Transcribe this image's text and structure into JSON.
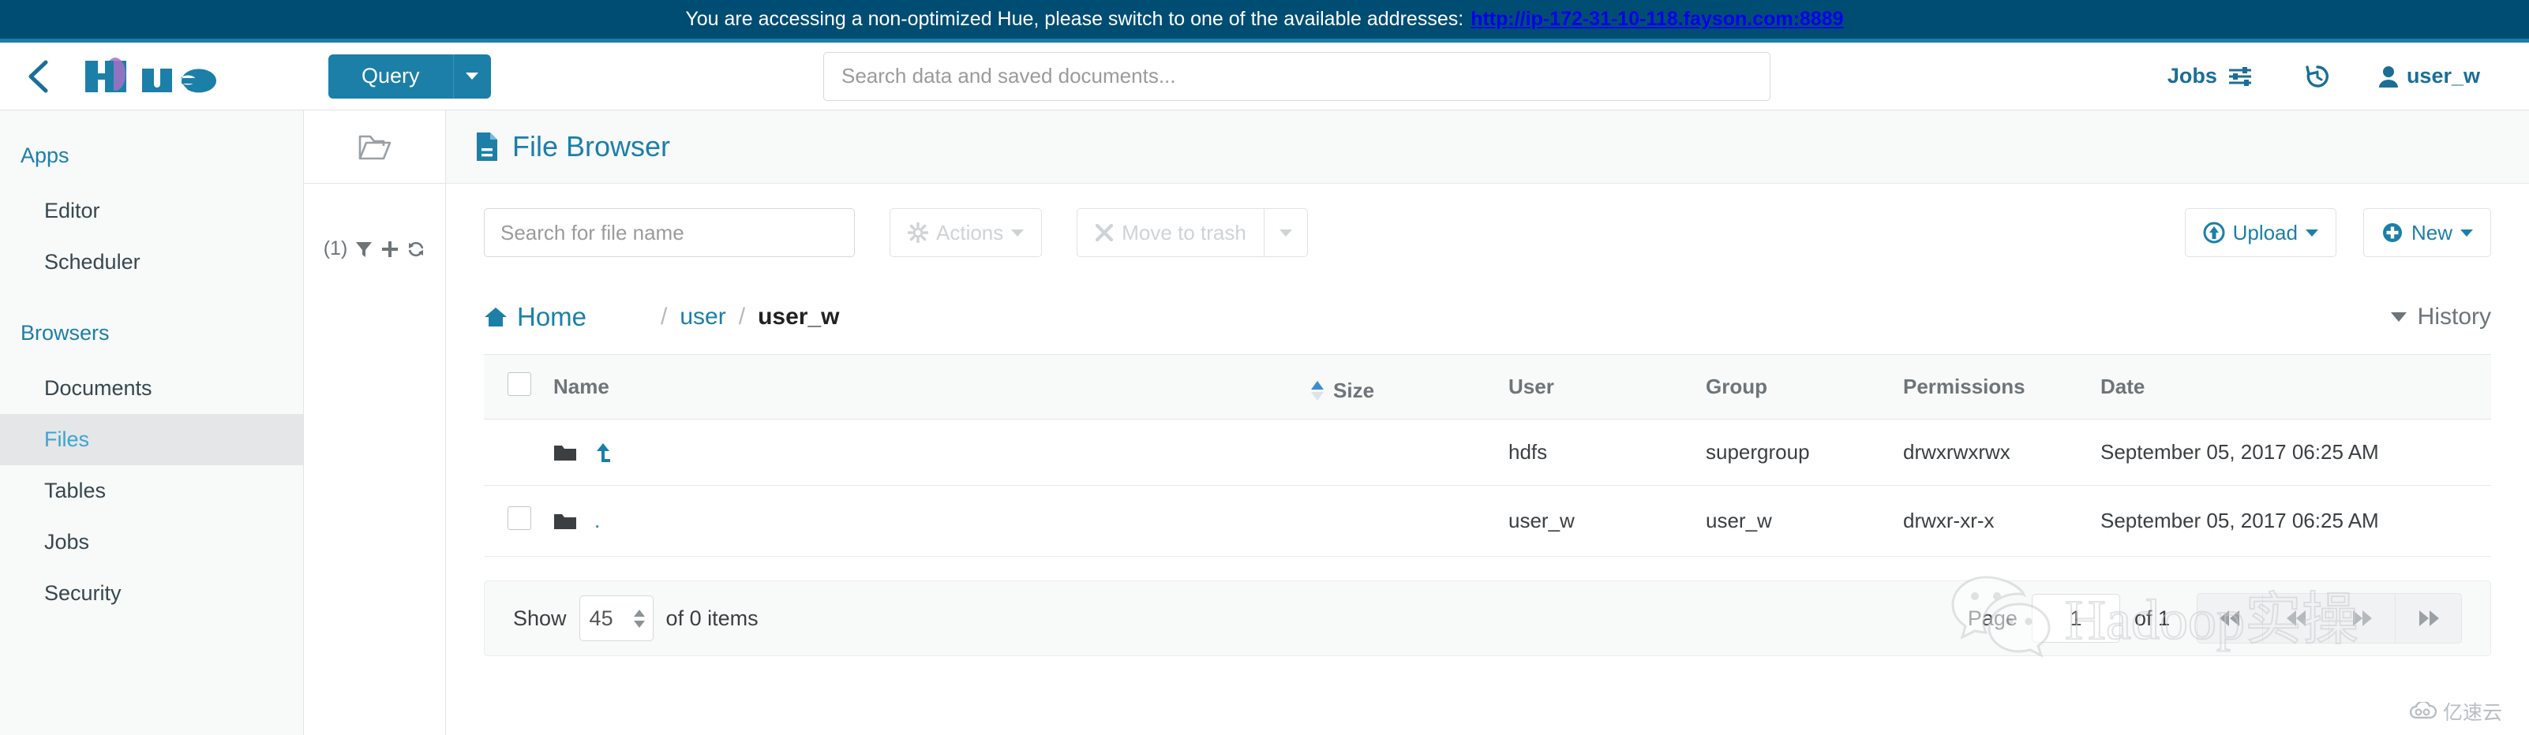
{
  "notice": {
    "message": "You are accessing a non-optimized Hue, please switch to one of the available addresses:",
    "url": "http://ip-172-31-10-118.fayson.com:8889"
  },
  "header": {
    "logo_text": "hue",
    "query_label": "Query",
    "search_placeholder": "Search data and saved documents...",
    "jobs_label": "Jobs",
    "user_label": "user_w"
  },
  "sidebar": {
    "groups": [
      {
        "title": "Apps",
        "items": [
          {
            "label": "Editor"
          },
          {
            "label": "Scheduler"
          }
        ]
      },
      {
        "title": "Browsers",
        "items": [
          {
            "label": "Documents"
          },
          {
            "label": "Files"
          },
          {
            "label": "Tables"
          },
          {
            "label": "Jobs"
          },
          {
            "label": "Security"
          }
        ]
      }
    ]
  },
  "assist": {
    "count_label": "(1)"
  },
  "page": {
    "title": "File Browser"
  },
  "toolbar": {
    "file_search_placeholder": "Search for file name",
    "actions_label": "Actions",
    "trash_label": "Move to trash",
    "upload_label": "Upload",
    "new_label": "New"
  },
  "breadcrumb": {
    "home_label": "Home",
    "separator": "/",
    "parts": [
      {
        "label": "user",
        "current": false
      },
      {
        "label": "user_w",
        "current": true
      }
    ],
    "history_label": "History"
  },
  "table": {
    "columns": [
      "Name",
      "Size",
      "User",
      "Group",
      "Permissions",
      "Date"
    ],
    "sorted_column": "Name",
    "sort_direction": "asc",
    "rows": [
      {
        "name": "..",
        "is_parent": true,
        "has_checkbox": false,
        "size": "",
        "user": "hdfs",
        "group": "supergroup",
        "permissions": "drwxrwxrwx",
        "date": "September 05, 2017 06:25 AM"
      },
      {
        "name": ".",
        "is_parent": false,
        "has_checkbox": true,
        "size": "",
        "user": "user_w",
        "group": "user_w",
        "permissions": "drwxr-xr-x",
        "date": "September 05, 2017 06:25 AM"
      }
    ]
  },
  "pager": {
    "show_label": "Show",
    "page_size": "45",
    "of_items_label": "of 0 items",
    "page_label": "Page",
    "current_page": "1",
    "of_pages_label": "of 1"
  },
  "watermarks": {
    "hadoop_text": "Hadoop实操",
    "corner_text": "亿速云"
  },
  "colors": {
    "banner_bg": "#004d73",
    "banner_rule": "#1b7fa8",
    "accent_teal": "#1b7fa8",
    "link_blue": "#3ba4d4",
    "sidebar_bg": "#f8f9f9"
  }
}
